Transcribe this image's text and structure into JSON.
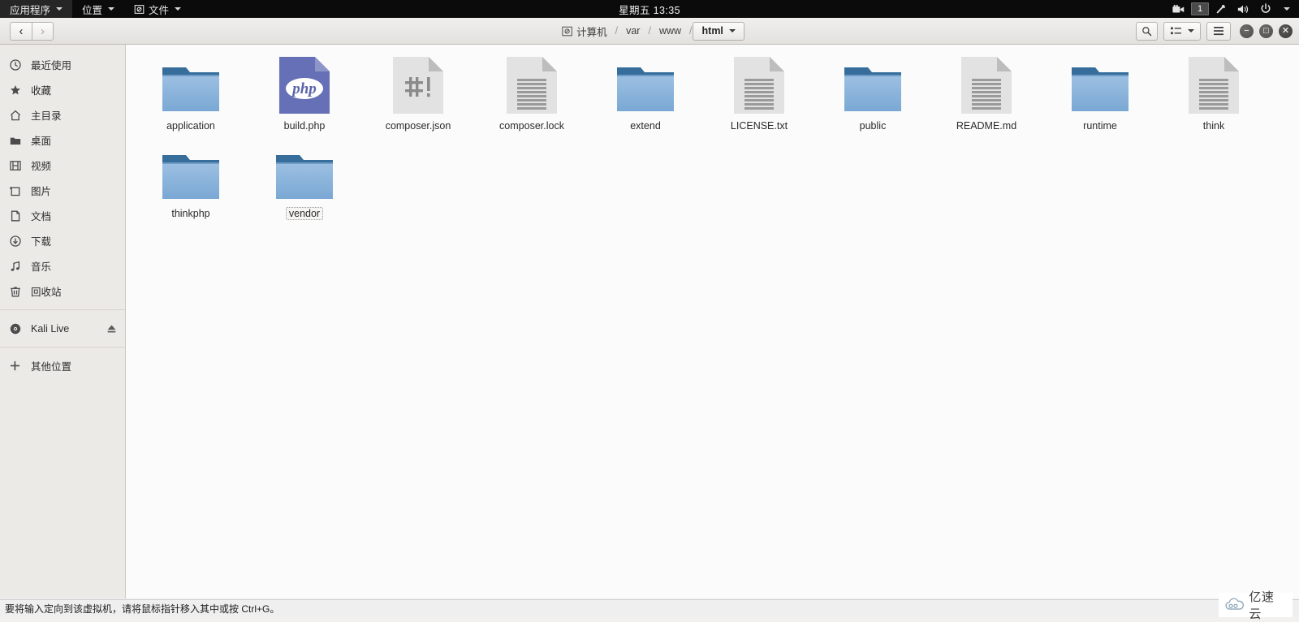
{
  "panel": {
    "menus": [
      {
        "label": "应用程序",
        "icon": "none",
        "name": "applications-menu"
      },
      {
        "label": "位置",
        "icon": "none",
        "name": "places-menu"
      },
      {
        "label": "文件",
        "icon": "files-app-icon",
        "name": "files-menu"
      }
    ],
    "clock": "星期五 13:35",
    "tray": {
      "screencast_icon": "video-camera-icon",
      "workspace": "1",
      "network_icon": "network-icon",
      "volume_icon": "volume-icon",
      "power_icon": "power-icon",
      "menu_icon": "chevron-down-icon"
    }
  },
  "headerbar": {
    "back_label": "‹",
    "forward_label": "›",
    "breadcrumbs": [
      {
        "label": "计算机",
        "icon": "computer-icon",
        "current": false
      },
      {
        "label": "var",
        "icon": "none",
        "current": false
      },
      {
        "label": "www",
        "icon": "none",
        "current": false
      },
      {
        "label": "html",
        "icon": "chevron-down-icon",
        "current": true
      }
    ],
    "separator": "/",
    "search_icon": "search-icon",
    "view_icon": "list-view-icon",
    "view_caret_icon": "chevron-down-icon",
    "menu_icon": "hamburger-menu-icon",
    "minimize_label": "−",
    "maximize_label": "□",
    "close_label": "✕"
  },
  "sidebar": {
    "items": [
      {
        "label": "最近使用",
        "icon": "clock-icon",
        "name": "sidebar-item-recent"
      },
      {
        "label": "收藏",
        "icon": "star-icon",
        "name": "sidebar-item-starred"
      },
      {
        "label": "主目录",
        "icon": "home-icon",
        "name": "sidebar-item-home"
      },
      {
        "label": "桌面",
        "icon": "folder-icon",
        "name": "sidebar-item-desktop"
      },
      {
        "label": "视频",
        "icon": "film-icon",
        "name": "sidebar-item-videos"
      },
      {
        "label": "图片",
        "icon": "picture-icon",
        "name": "sidebar-item-pictures"
      },
      {
        "label": "文档",
        "icon": "document-icon",
        "name": "sidebar-item-documents"
      },
      {
        "label": "下载",
        "icon": "download-icon",
        "name": "sidebar-item-downloads"
      },
      {
        "label": "音乐",
        "icon": "music-note-icon",
        "name": "sidebar-item-music"
      },
      {
        "label": "回收站",
        "icon": "trash-icon",
        "name": "sidebar-item-trash"
      }
    ],
    "devices": [
      {
        "label": "Kali Live",
        "icon": "disc-icon",
        "action_icon": "eject-icon",
        "name": "sidebar-item-kali-live"
      }
    ],
    "other": {
      "label": "其他位置",
      "icon": "plus-icon",
      "name": "sidebar-item-other-locations"
    }
  },
  "files": [
    {
      "name": "application",
      "type": "folder",
      "focused": false
    },
    {
      "name": "build.php",
      "type": "php",
      "focused": false
    },
    {
      "name": "composer.json",
      "type": "script",
      "focused": false
    },
    {
      "name": "composer.lock",
      "type": "text",
      "focused": false
    },
    {
      "name": "extend",
      "type": "folder",
      "focused": false
    },
    {
      "name": "LICENSE.txt",
      "type": "text",
      "focused": false
    },
    {
      "name": "public",
      "type": "folder",
      "focused": false
    },
    {
      "name": "README.md",
      "type": "text",
      "focused": false
    },
    {
      "name": "runtime",
      "type": "folder",
      "focused": false
    },
    {
      "name": "think",
      "type": "text",
      "focused": false
    },
    {
      "name": "thinkphp",
      "type": "folder",
      "focused": false
    },
    {
      "name": "vendor",
      "type": "folder",
      "focused": true
    }
  ],
  "statusbar": {
    "message": "要将输入定向到该虚拟机，请将鼠标指针移入其中或按 Ctrl+G。",
    "device_icons": [
      "hard-disk-icon",
      "cd-drive-icon",
      "network-adapter-icon",
      "printer-icon",
      "usb-icon"
    ],
    "watermark": {
      "text": "亿速云",
      "icon": "cloud-icon"
    }
  },
  "colors": {
    "panel_bg": "#0b0b0b",
    "folder_blue": "#7daad6",
    "folder_tab": "#336b99",
    "php_purple": "#6570b6",
    "doc_gray": "#e2e2e2",
    "content_bg": "#fbfbfb",
    "sidebar_bg": "#eceae7"
  }
}
